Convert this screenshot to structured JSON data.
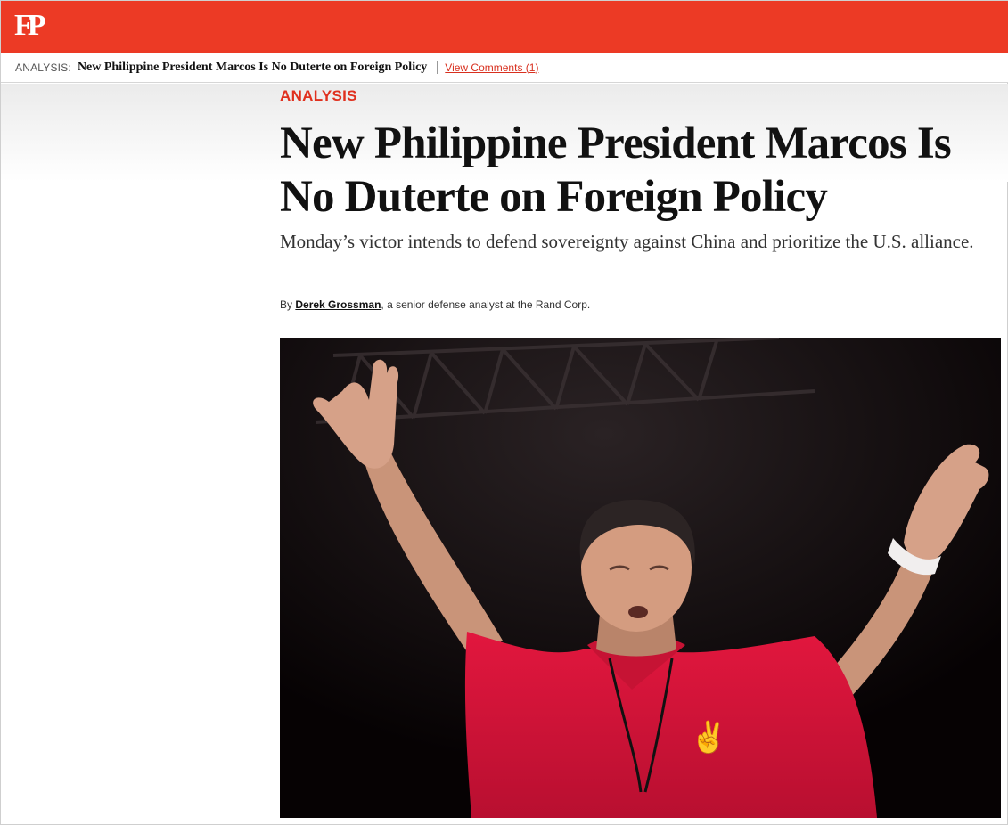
{
  "brand": {
    "logo_text": "FP",
    "bar_color": "#ec3a25"
  },
  "sticky_header": {
    "kicker": "ANALYSIS:",
    "title": "New Philippine President Marcos Is No Duterte on Foreign Policy",
    "comments_link": "View Comments (1)"
  },
  "article": {
    "kicker": "ANALYSIS",
    "headline": "New Philippine President Marcos Is No Duterte on Foreign Policy",
    "dek": "Monday’s victor intends to defend sovereignty against China and prioritize the U.S. alliance.",
    "byline": {
      "prefix": "By",
      "author": "Derek Grossman",
      "suffix": ", a senior defense analyst at the Rand Corp."
    }
  },
  "colors": {
    "accent": "#e0301e",
    "link": "#d8301f",
    "text": "#111111"
  }
}
